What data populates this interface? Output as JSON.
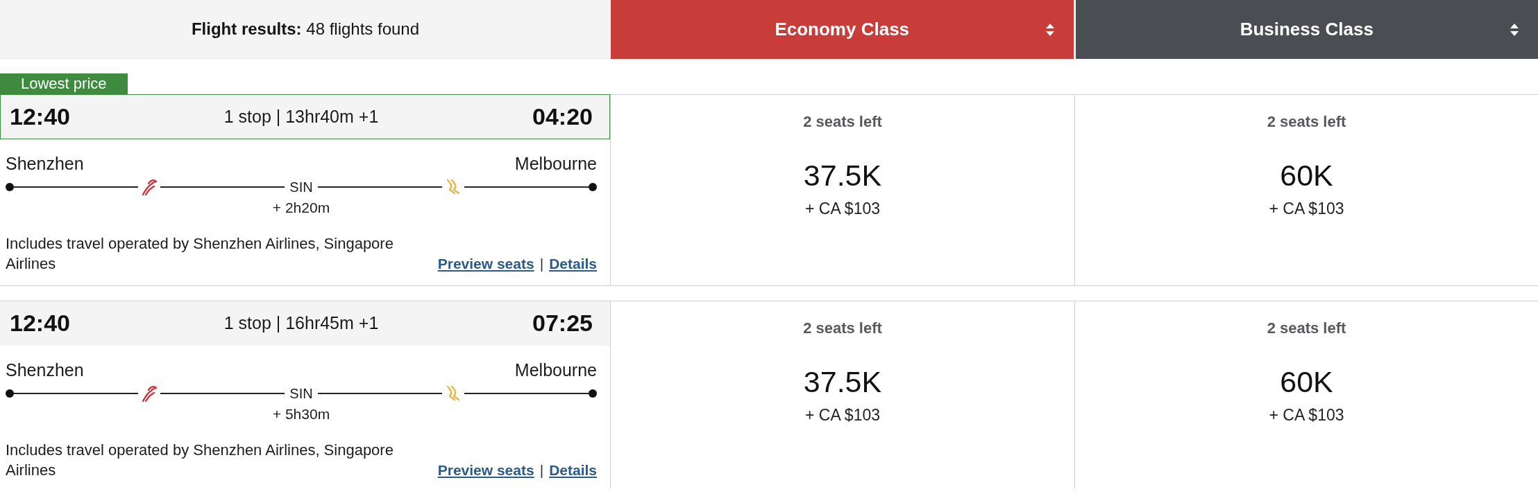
{
  "results_header": {
    "text": "**Flight results:** 48 flights found"
  },
  "cabin_columns": [
    {
      "label": "Economy Class",
      "selected": true
    },
    {
      "label": "Business Class",
      "selected": false
    }
  ],
  "flights": [
    {
      "badge": "Lowest price",
      "highlighted": true,
      "departure_time": "12:40",
      "summary": "1 stop | 13hr40m +1",
      "arrival_time": "04:20",
      "origin": "Shenzhen",
      "destination": "Melbourne",
      "stop_code": "SIN",
      "layover": "+ 2h20m",
      "operators_note": "Includes travel operated by Shenzhen Airlines, Singapore Airlines",
      "links": [
        "Preview seats",
        "Details"
      ],
      "link_separator": "|",
      "fares": [
        {
          "seats_left": "2 seats left",
          "points": "37.5K",
          "cash": "+ CA $103"
        },
        {
          "seats_left": "2 seats left",
          "points": "60K",
          "cash": "+ CA $103"
        }
      ]
    },
    {
      "highlighted": false,
      "departure_time": "12:40",
      "summary": "1 stop | 16hr45m +1",
      "arrival_time": "07:25",
      "origin": "Shenzhen",
      "destination": "Melbourne",
      "stop_code": "SIN",
      "layover": "+ 5h30m",
      "operators_note": "Includes travel operated by Shenzhen Airlines, Singapore Airlines",
      "links": [
        "Preview seats",
        "Details"
      ],
      "link_separator": "|",
      "fares": [
        {
          "seats_left": "2 seats left",
          "points": "37.5K",
          "cash": "+ CA $103"
        },
        {
          "seats_left": "2 seats left",
          "points": "60K",
          "cash": "+ CA $103"
        }
      ]
    }
  ]
}
